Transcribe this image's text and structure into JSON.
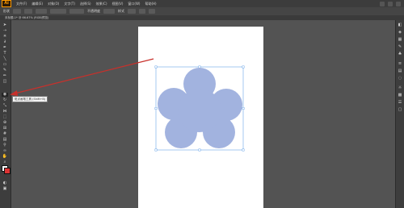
{
  "app": {
    "logo_text": "Ai",
    "menus": [
      "文件(F)",
      "编辑(E)",
      "对象(O)",
      "文字(T)",
      "选择(S)",
      "效果(C)",
      "视图(V)",
      "窗口(W)",
      "帮助(H)"
    ]
  },
  "controlbar": {
    "shape_label": "形状",
    "opacity_label": "不透明度",
    "style_label": "样式"
  },
  "document": {
    "tab_label": "未标题-1* @ 66.67% (RGB/预览)"
  },
  "tooltip": {
    "text": "斑点画笔工具 (Shift+B)"
  },
  "colors": {
    "flower_fill": "#a2b3df",
    "selection": "#6aa6e8",
    "annotation_arrow": "#c8302b"
  }
}
